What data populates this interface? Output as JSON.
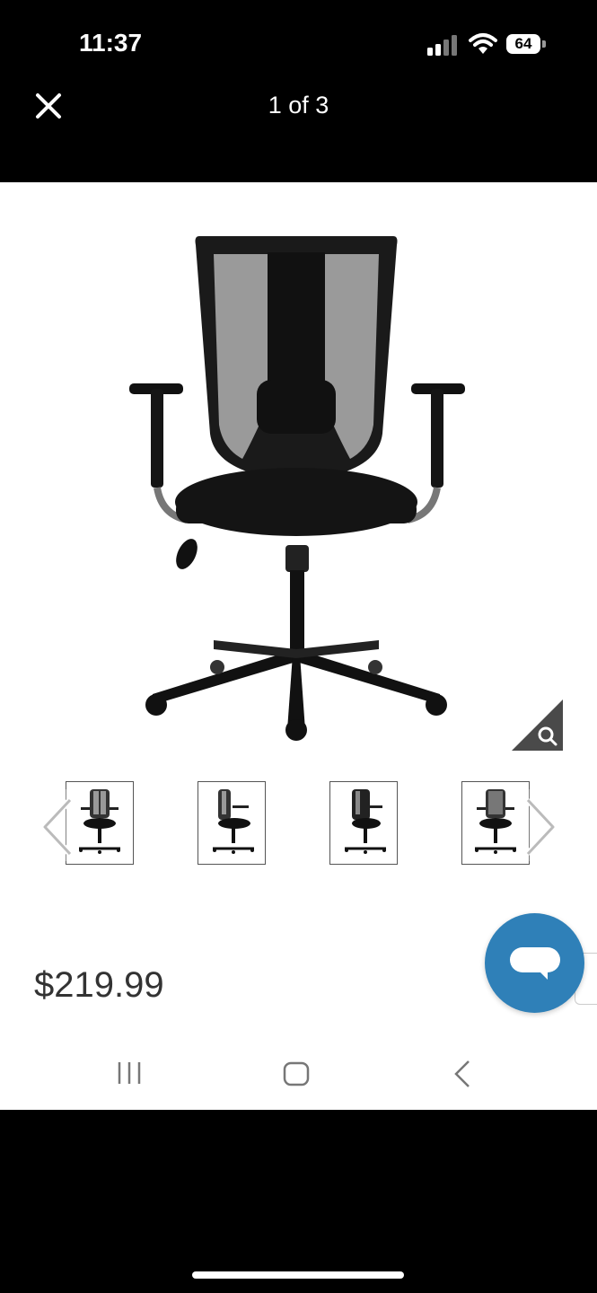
{
  "status_bar": {
    "time": "11:37",
    "battery": "64",
    "icons": [
      "signal-icon",
      "wifi-icon",
      "battery-icon"
    ]
  },
  "viewer": {
    "counter": "1 of 3",
    "close_icon": "close-icon",
    "zoom_icon": "search-icon"
  },
  "thumbnails": {
    "prev_icon": "chevron-left-icon",
    "next_icon": "chevron-right-icon",
    "items": [
      "chair-front-view",
      "chair-side-view",
      "chair-angle-view",
      "chair-back-view"
    ]
  },
  "product": {
    "price": "$219.99"
  },
  "chat": {
    "icon": "chat-icon",
    "color": "#2f80b8"
  },
  "nav_bar": {
    "icons": [
      "recents-icon",
      "home-icon",
      "back-icon"
    ]
  }
}
